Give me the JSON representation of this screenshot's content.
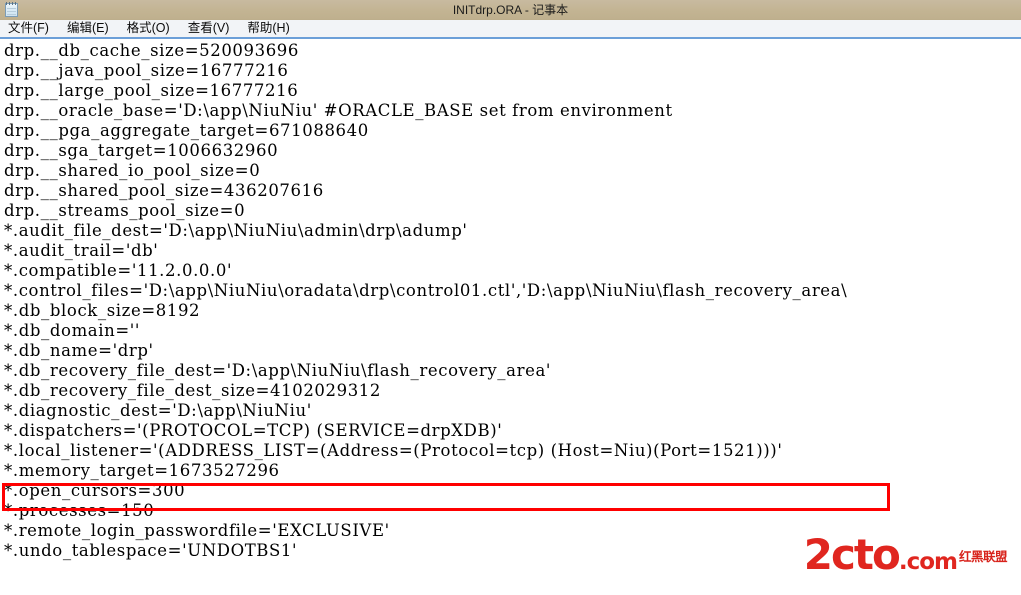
{
  "window": {
    "title": "INITdrp.ORA - 记事本",
    "icon": "notepad-icon"
  },
  "menubar": {
    "items": [
      {
        "label": "文件(F)"
      },
      {
        "label": "编辑(E)"
      },
      {
        "label": "格式(O)"
      },
      {
        "label": "查看(V)"
      },
      {
        "label": "帮助(H)"
      }
    ]
  },
  "document": {
    "lines": [
      "drp.__db_cache_size=520093696",
      "drp.__java_pool_size=16777216",
      "drp.__large_pool_size=16777216",
      "drp.__oracle_base='D:\\app\\NiuNiu' #ORACLE_BASE set from environment",
      "drp.__pga_aggregate_target=671088640",
      "drp.__sga_target=1006632960",
      "drp.__shared_io_pool_size=0",
      "drp.__shared_pool_size=436207616",
      "drp.__streams_pool_size=0",
      "*.audit_file_dest='D:\\app\\NiuNiu\\admin\\drp\\adump'",
      "*.audit_trail='db'",
      "*.compatible='11.2.0.0.0'",
      "*.control_files='D:\\app\\NiuNiu\\oradata\\drp\\control01.ctl','D:\\app\\NiuNiu\\flash_recovery_area\\",
      "*.db_block_size=8192",
      "*.db_domain=''",
      "*.db_name='drp'",
      "*.db_recovery_file_dest='D:\\app\\NiuNiu\\flash_recovery_area'",
      "*.db_recovery_file_dest_size=4102029312",
      "*.diagnostic_dest='D:\\app\\NiuNiu'",
      "*.dispatchers='(PROTOCOL=TCP) (SERVICE=drpXDB)'",
      "*.local_listener='(ADDRESS_LIST=(Address=(Protocol=tcp) (Host=Niu)(Port=1521)))'",
      "*.memory_target=1673527296",
      "*.open_cursors=300",
      "*.processes=150",
      "*.remote_login_passwordfile='EXCLUSIVE'",
      "*.undo_tablespace='UNDOTBS1'"
    ]
  },
  "annotation": {
    "name": "local-listener-highlight",
    "color": "#ff0000",
    "target_line_index": 20
  },
  "watermark": {
    "main": "2cto",
    "suffix": ".com",
    "chinese": "红黑联盟",
    "color": "#e0261f"
  },
  "colors": {
    "titlebar": "#c3b493",
    "menubar": "#f2f4f7",
    "menubar_underline": "#6c9fd8",
    "text": "#000000",
    "background": "#ffffff",
    "highlight": "#ff0000"
  }
}
